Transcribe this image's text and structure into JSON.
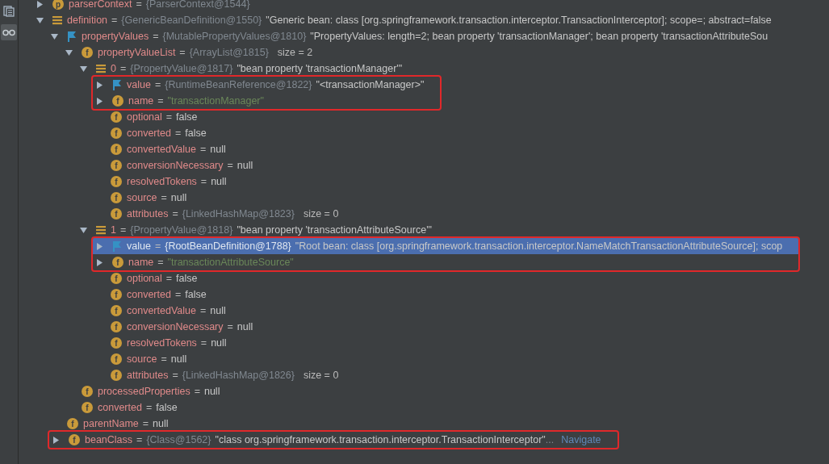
{
  "toolbar": [
    {
      "kind": "frames",
      "selected": false
    },
    {
      "kind": "watches",
      "selected": true
    }
  ],
  "tree": [
    {
      "kind": "field",
      "badge": "p",
      "name": "parserContext",
      "sep": "=",
      "type": "{ParserContext@1544}",
      "expanded": false
    },
    {
      "kind": "list",
      "name": "definition",
      "sep": "=",
      "type": "{GenericBeanDefinition@1550}",
      "value": "\"Generic bean: class [org.springframework.transaction.interceptor.TransactionInterceptor]; scope=; abstract=false",
      "expanded": true,
      "children": [
        {
          "kind": "flag",
          "name": "propertyValues",
          "sep": "=",
          "type": "{MutablePropertyValues@1810}",
          "value": "\"PropertyValues: length=2; bean property 'transactionManager'; bean property 'transactionAttributeSou",
          "expanded": true,
          "children": [
            {
              "kind": "field",
              "badge": "f",
              "name": "propertyValueList",
              "sep": "=",
              "type": "{ArrayList@1815}",
              "extra": "size = 2",
              "expanded": true,
              "children": [
                {
                  "kind": "list",
                  "name": "0",
                  "sep": "=",
                  "type": "{PropertyValue@1817}",
                  "value": "\"bean property 'transactionManager'\"",
                  "expanded": true,
                  "children": [
                    {
                      "kind": "flag",
                      "name": "value",
                      "sep": "=",
                      "type": "{RuntimeBeanReference@1822}",
                      "value": "\"<transactionManager>\"",
                      "expanded": false,
                      "annotated": true
                    },
                    {
                      "kind": "field",
                      "badge": "f",
                      "name": "name",
                      "sep": "=",
                      "value": "\"transactionManager\"",
                      "is_string": true,
                      "expanded": false,
                      "annotated": true
                    },
                    {
                      "kind": "field",
                      "badge": "f",
                      "name": "optional",
                      "sep": "=",
                      "value": "false"
                    },
                    {
                      "kind": "field",
                      "badge": "f",
                      "name": "converted",
                      "sep": "=",
                      "value": "false"
                    },
                    {
                      "kind": "field",
                      "badge": "f",
                      "name": "convertedValue",
                      "sep": "=",
                      "value": "null"
                    },
                    {
                      "kind": "field",
                      "badge": "f",
                      "name": "conversionNecessary",
                      "sep": "=",
                      "value": "null"
                    },
                    {
                      "kind": "field",
                      "badge": "f",
                      "name": "resolvedTokens",
                      "sep": "=",
                      "value": "null"
                    },
                    {
                      "kind": "field",
                      "badge": "f",
                      "name": "source",
                      "sep": "=",
                      "value": "null"
                    },
                    {
                      "kind": "field",
                      "badge": "f",
                      "name": "attributes",
                      "sep": "=",
                      "type": "{LinkedHashMap@1823}",
                      "extra": "size = 0"
                    }
                  ]
                },
                {
                  "kind": "list",
                  "name": "1",
                  "sep": "=",
                  "type": "{PropertyValue@1818}",
                  "value": "\"bean property 'transactionAttributeSource'\"",
                  "expanded": true,
                  "children": [
                    {
                      "kind": "flag",
                      "name": "value",
                      "sep": "=",
                      "type": "{RootBeanDefinition@1788}",
                      "value": "\"Root bean: class [org.springframework.transaction.interceptor.NameMatchTransactionAttributeSource]; scop",
                      "expanded": false,
                      "annotated": true,
                      "selected": true
                    },
                    {
                      "kind": "field",
                      "badge": "f",
                      "name": "name",
                      "sep": "=",
                      "value": "\"transactionAttributeSource\"",
                      "is_string": true,
                      "expanded": false,
                      "annotated": true
                    },
                    {
                      "kind": "field",
                      "badge": "f",
                      "name": "optional",
                      "sep": "=",
                      "value": "false"
                    },
                    {
                      "kind": "field",
                      "badge": "f",
                      "name": "converted",
                      "sep": "=",
                      "value": "false"
                    },
                    {
                      "kind": "field",
                      "badge": "f",
                      "name": "convertedValue",
                      "sep": "=",
                      "value": "null"
                    },
                    {
                      "kind": "field",
                      "badge": "f",
                      "name": "conversionNecessary",
                      "sep": "=",
                      "value": "null"
                    },
                    {
                      "kind": "field",
                      "badge": "f",
                      "name": "resolvedTokens",
                      "sep": "=",
                      "value": "null"
                    },
                    {
                      "kind": "field",
                      "badge": "f",
                      "name": "source",
                      "sep": "=",
                      "value": "null"
                    },
                    {
                      "kind": "field",
                      "badge": "f",
                      "name": "attributes",
                      "sep": "=",
                      "type": "{LinkedHashMap@1826}",
                      "extra": "size = 0"
                    }
                  ]
                }
              ]
            },
            {
              "kind": "field",
              "badge": "f",
              "name": "processedProperties",
              "sep": "=",
              "value": "null"
            },
            {
              "kind": "field",
              "badge": "f",
              "name": "converted",
              "sep": "=",
              "value": "false"
            }
          ]
        },
        {
          "kind": "field",
          "badge": "f",
          "name": "parentName",
          "sep": "=",
          "value": "null"
        },
        {
          "kind": "field",
          "badge": "f",
          "name": "beanClass",
          "sep": "=",
          "type": "{Class@1562}",
          "value": "\"class org.springframework.transaction.interceptor.TransactionInterceptor\"",
          "ellipsis": "...",
          "link": "Navigate",
          "expanded": false,
          "annotated": true
        }
      ]
    }
  ]
}
